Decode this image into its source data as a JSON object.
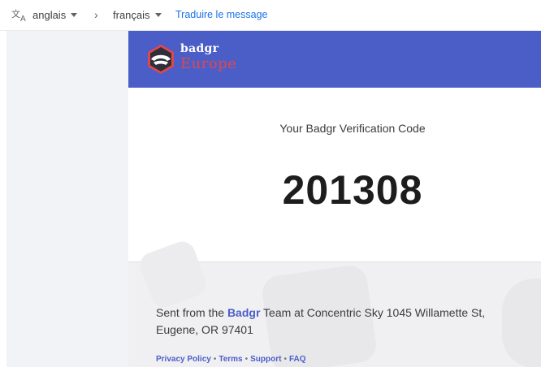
{
  "translate_bar": {
    "source_language": "anglais",
    "target_language": "français",
    "translate_link": "Traduire le message"
  },
  "email": {
    "header": {
      "brand_top": "badgr",
      "brand_bottom": "Europe",
      "colors": {
        "header_bg": "#4b5ec8",
        "brand_red": "#e0474c"
      }
    },
    "code_label": "Your Badgr Verification Code",
    "code_value": "201308",
    "footer": {
      "sent_prefix": "Sent from the ",
      "team_name": "Badgr",
      "sent_suffix": " Team at Concentric Sky 1045 Willamette St, Eugene, OR 97401",
      "links": [
        "Privacy Policy",
        "Terms",
        "Support",
        "FAQ"
      ],
      "separator": "•"
    }
  }
}
